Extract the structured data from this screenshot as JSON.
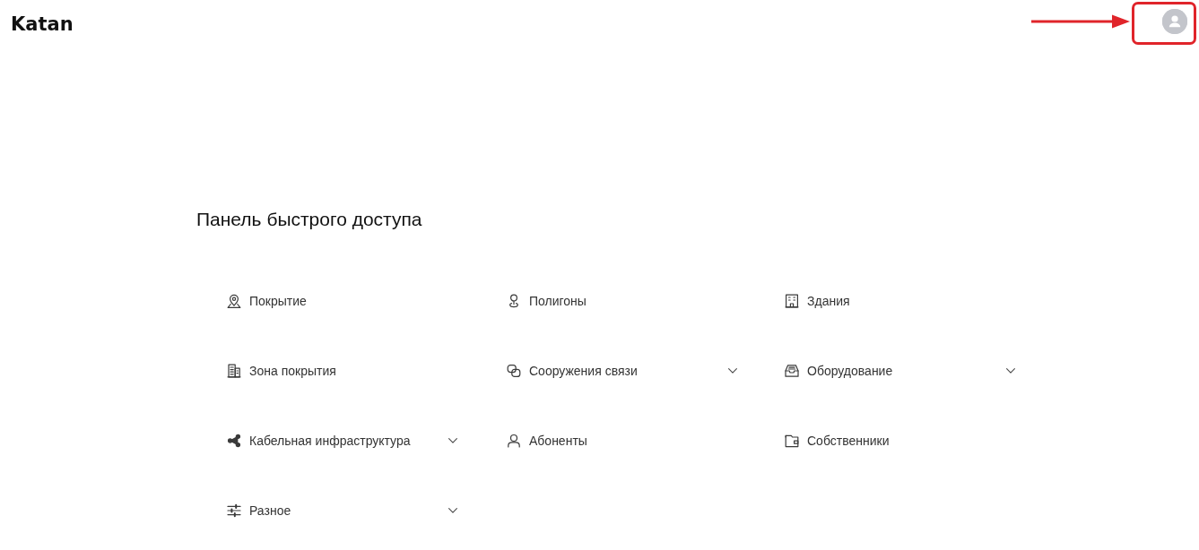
{
  "header": {
    "logo": "Katan"
  },
  "quick_access": {
    "title": "Панель быстрого доступа",
    "items": [
      {
        "label": "Покрытие",
        "kind": "link"
      },
      {
        "label": "Полигоны",
        "kind": "link"
      },
      {
        "label": "Здания",
        "kind": "link"
      },
      {
        "label": "Зона покрытия",
        "kind": "link"
      },
      {
        "label": "Сооружения связи",
        "kind": "dropdown"
      },
      {
        "label": "Оборудование",
        "kind": "dropdown"
      },
      {
        "label": "Кабельная инфраструктура",
        "kind": "dropdown"
      },
      {
        "label": "Абоненты",
        "kind": "link"
      },
      {
        "label": "Собственники",
        "kind": "link"
      },
      {
        "label": "Разное",
        "kind": "dropdown"
      }
    ]
  }
}
